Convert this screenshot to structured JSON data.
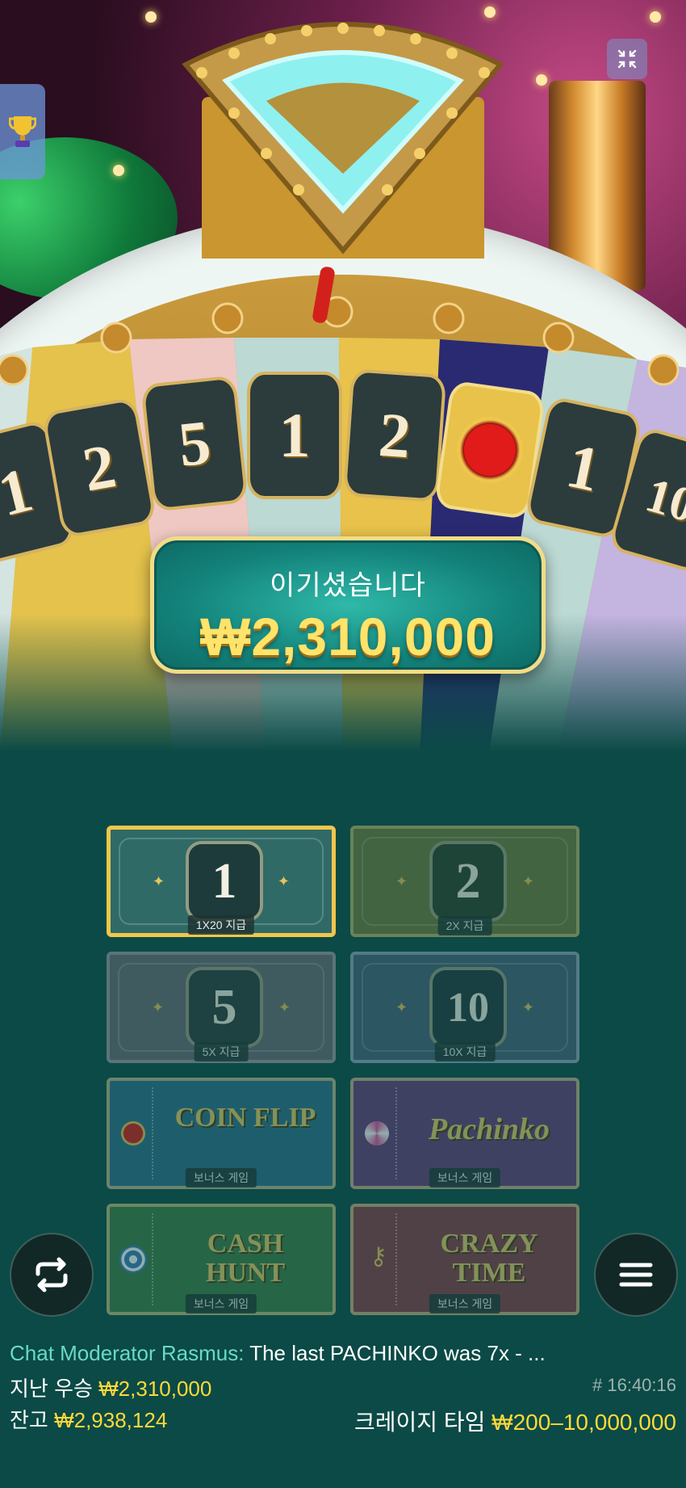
{
  "wheel": {
    "segments": [
      "1",
      "2",
      "5",
      "1",
      "2",
      "",
      "1",
      "10"
    ]
  },
  "win": {
    "title": "이기셨습니다",
    "amount": "₩2,310,000"
  },
  "bets": [
    {
      "value": "1",
      "label": "1X20 지급",
      "color": "#2f6a67",
      "border": "#f0c64c"
    },
    {
      "value": "2",
      "label": "2X 지급",
      "color": "#6f7a3c",
      "border": "#b8b06a"
    },
    {
      "value": "5",
      "label": "5X 지급",
      "color": "#6d6a74",
      "border": "#9c97a6"
    },
    {
      "value": "10",
      "label": "10X 지급",
      "color": "#48617a",
      "border": "#8fa4bd"
    }
  ],
  "bonus_games": [
    {
      "title": "COIN FLIP",
      "label": "보너스 게임",
      "color": "#2f6f8c"
    },
    {
      "title": "Pachinko",
      "label": "보너스 게임",
      "color": "#6a3a7c"
    },
    {
      "title": "CASH HUNT",
      "label": "보너스 게임",
      "color": "#3e7c48"
    },
    {
      "title": "CRAZY TIME",
      "label": "보너스 게임",
      "color": "#8a3a49"
    }
  ],
  "chat": {
    "author": "Chat Moderator Rasmus:",
    "message": "The last PACHINKO was 7x - ..."
  },
  "footer": {
    "last_win_label": "지난 우승",
    "last_win_value": "₩2,310,000",
    "balance_label": "잔고",
    "balance_value": "₩2,938,124",
    "game_id": "# 16:40:16",
    "game_name": "크레이지 타임",
    "limits": "₩200–10,000,000"
  },
  "icons": {
    "collapse": "collapse-icon",
    "trophy": "trophy-icon",
    "repeat": "repeat-icon",
    "menu": "menu-icon"
  }
}
